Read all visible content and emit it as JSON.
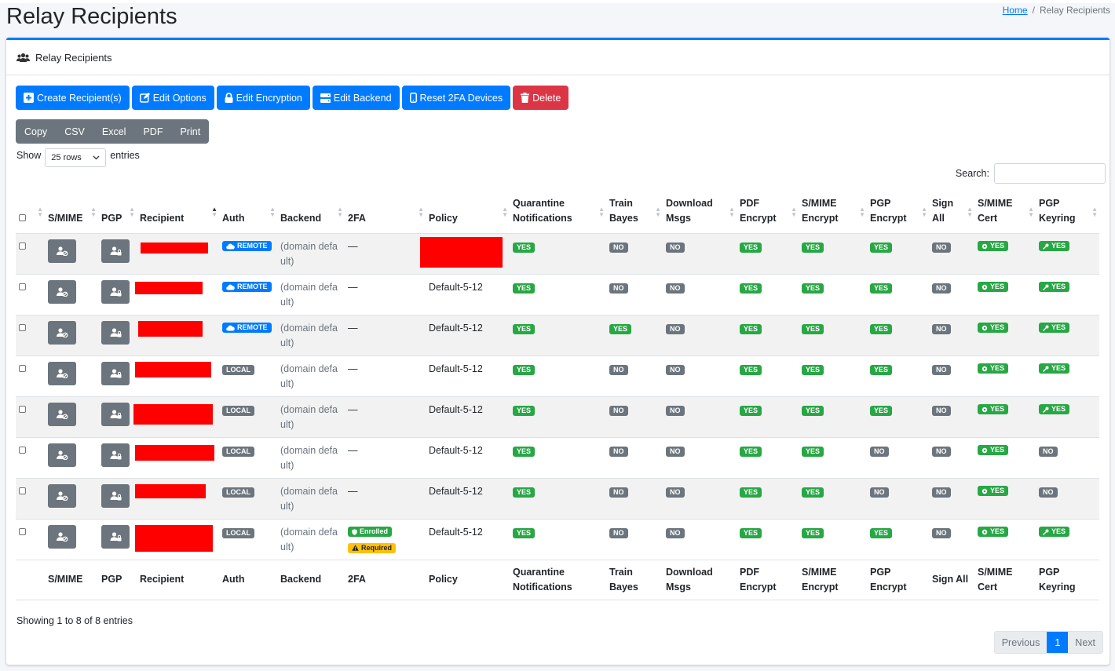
{
  "page": {
    "title": "Relay Recipients"
  },
  "breadcrumb": {
    "home": "Home",
    "separator": "/",
    "current": "Relay Recipients"
  },
  "card": {
    "title": "Relay Recipients"
  },
  "actions": {
    "create": "Create Recipient(s)",
    "edit_options": "Edit Options",
    "edit_encryption": "Edit Encryption",
    "edit_backend": "Edit Backend",
    "reset_2fa": "Reset 2FA Devices",
    "delete": "Delete"
  },
  "export": {
    "copy": "Copy",
    "csv": "CSV",
    "excel": "Excel",
    "pdf": "PDF",
    "print": "Print"
  },
  "length": {
    "show": "Show",
    "value": "25 rows",
    "entries": "entries"
  },
  "search": {
    "label": "Search:",
    "value": ""
  },
  "columns": {
    "smime": "S/MIME",
    "pgp": "PGP",
    "recipient": "Recipient",
    "auth": "Auth",
    "backend": "Backend",
    "twofa": "2FA",
    "policy": "Policy",
    "quarantine_1": "Quarantine",
    "quarantine_2": "Notifications",
    "train_1": "Train",
    "train_2": "Bayes",
    "download_1": "Download",
    "download_2": "Msgs",
    "pdf_1": "PDF",
    "pdf_2": "Encrypt",
    "smime_enc_1": "S/MIME",
    "smime_enc_2": "Encrypt",
    "pgp_enc_1": "PGP",
    "pgp_enc_2": "Encrypt",
    "sign_1": "Sign",
    "sign_2": "All",
    "smime_cert_1": "S/MIME",
    "smime_cert_2": "Cert",
    "pgp_key_1": "PGP",
    "pgp_key_2": "Keyring"
  },
  "footer_columns": {
    "smime": "S/MIME",
    "pgp": "PGP",
    "recipient": "Recipient",
    "auth": "Auth",
    "backend": "Backend",
    "twofa": "2FA",
    "policy": "Policy",
    "quarantine_1": "Quarantine",
    "quarantine_2": "Notifications",
    "train_1": "Train",
    "train_2": "Bayes",
    "download_1": "Download",
    "download_2": "Msgs",
    "pdf": "PDF Encrypt",
    "smime_enc_1": "S/MIME",
    "smime_enc_2": "Encrypt",
    "pgp_enc": "PGP Encrypt",
    "sign": "Sign All",
    "smime_cert": "S/MIME Cert",
    "pgp_key": "PGP Keyring"
  },
  "rows": [
    {
      "auth": "REMOTE",
      "backend_1": "(domain defa",
      "backend_2": "ult)",
      "twofa": "—",
      "policy": "",
      "quarantine": "YES",
      "train": "NO",
      "download": "NO",
      "pdf": "YES",
      "smime_enc": "YES",
      "pgp_enc": "YES",
      "sign": "NO",
      "smime_cert": "YES",
      "pgp_key": "YES"
    },
    {
      "auth": "REMOTE",
      "backend_1": "(domain defa",
      "backend_2": "ult)",
      "twofa": "—",
      "policy": "Default-5-12",
      "quarantine": "YES",
      "train": "NO",
      "download": "NO",
      "pdf": "YES",
      "smime_enc": "YES",
      "pgp_enc": "YES",
      "sign": "NO",
      "smime_cert": "YES",
      "pgp_key": "YES"
    },
    {
      "auth": "REMOTE",
      "backend_1": "(domain defa",
      "backend_2": "ult)",
      "twofa": "—",
      "policy": "Default-5-12",
      "quarantine": "YES",
      "train": "YES",
      "download": "NO",
      "pdf": "YES",
      "smime_enc": "YES",
      "pgp_enc": "YES",
      "sign": "NO",
      "smime_cert": "YES",
      "pgp_key": "YES"
    },
    {
      "auth": "LOCAL",
      "backend_1": "(domain defa",
      "backend_2": "ult)",
      "twofa": "—",
      "policy": "Default-5-12",
      "quarantine": "YES",
      "train": "NO",
      "download": "NO",
      "pdf": "YES",
      "smime_enc": "YES",
      "pgp_enc": "YES",
      "sign": "NO",
      "smime_cert": "YES",
      "pgp_key": "YES"
    },
    {
      "auth": "LOCAL",
      "backend_1": "(domain defa",
      "backend_2": "ult)",
      "twofa": "—",
      "policy": "Default-5-12",
      "quarantine": "YES",
      "train": "NO",
      "download": "NO",
      "pdf": "YES",
      "smime_enc": "YES",
      "pgp_enc": "YES",
      "sign": "NO",
      "smime_cert": "YES",
      "pgp_key": "YES"
    },
    {
      "auth": "LOCAL",
      "backend_1": "(domain defa",
      "backend_2": "ult)",
      "twofa": "—",
      "policy": "Default-5-12",
      "quarantine": "YES",
      "train": "NO",
      "download": "NO",
      "pdf": "YES",
      "smime_enc": "YES",
      "pgp_enc": "NO",
      "sign": "NO",
      "smime_cert": "YES",
      "pgp_key": "NO"
    },
    {
      "auth": "LOCAL",
      "backend_1": "(domain defa",
      "backend_2": "ult)",
      "twofa": "—",
      "policy": "Default-5-12",
      "quarantine": "YES",
      "train": "NO",
      "download": "NO",
      "pdf": "YES",
      "smime_enc": "YES",
      "pgp_enc": "NO",
      "sign": "NO",
      "smime_cert": "YES",
      "pgp_key": "NO"
    },
    {
      "auth": "LOCAL",
      "backend_1": "(domain defa",
      "backend_2": "ult)",
      "twofa_enrolled": "Enrolled",
      "twofa_required": "Required",
      "policy": "Default-5-12",
      "quarantine": "YES",
      "train": "NO",
      "download": "NO",
      "pdf": "YES",
      "smime_enc": "YES",
      "pgp_enc": "YES",
      "sign": "NO",
      "smime_cert": "YES",
      "pgp_key": "YES"
    }
  ],
  "info": "Showing 1 to 8 of 8 entries",
  "pagination": {
    "previous": "Previous",
    "page": "1",
    "next": "Next"
  },
  "colors": {
    "primary": "#007bff",
    "success": "#28a745",
    "secondary": "#6c757d",
    "danger": "#dc3545",
    "warning": "#ffc107",
    "redaction": "#ff0000"
  }
}
